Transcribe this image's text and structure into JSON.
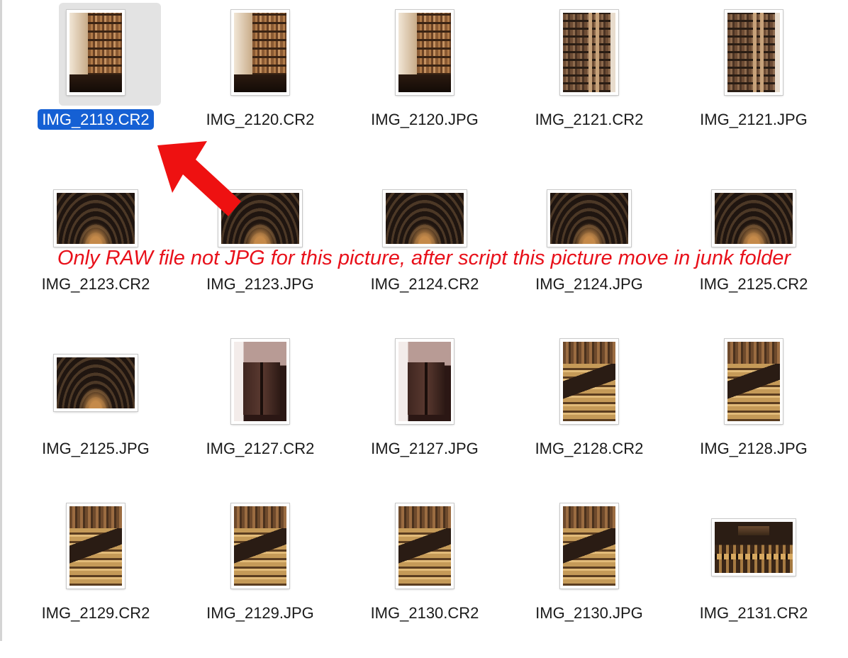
{
  "files": [
    {
      "name": "IMG_2119.CR2",
      "photo": "shelf-tall",
      "orientation": "portrait",
      "selected": true
    },
    {
      "name": "IMG_2120.CR2",
      "photo": "shelf-tall",
      "orientation": "portrait"
    },
    {
      "name": "IMG_2120.JPG",
      "photo": "shelf-tall",
      "orientation": "portrait"
    },
    {
      "name": "IMG_2121.CR2",
      "photo": "ladder",
      "orientation": "portrait"
    },
    {
      "name": "IMG_2121.JPG",
      "photo": "ladder",
      "orientation": "portrait"
    },
    {
      "name": "IMG_2123.CR2",
      "photo": "hall",
      "orientation": "landscape"
    },
    {
      "name": "IMG_2123.JPG",
      "photo": "hall",
      "orientation": "landscape"
    },
    {
      "name": "IMG_2124.CR2",
      "photo": "hall",
      "orientation": "landscape"
    },
    {
      "name": "IMG_2124.JPG",
      "photo": "hall",
      "orientation": "landscape"
    },
    {
      "name": "IMG_2125.CR2",
      "photo": "hall",
      "orientation": "landscape"
    },
    {
      "name": "IMG_2125.JPG",
      "photo": "hall",
      "orientation": "landscape"
    },
    {
      "name": "IMG_2127.CR2",
      "photo": "column",
      "orientation": "portrait"
    },
    {
      "name": "IMG_2127.JPG",
      "photo": "column",
      "orientation": "portrait"
    },
    {
      "name": "IMG_2128.CR2",
      "photo": "balcony",
      "orientation": "portrait"
    },
    {
      "name": "IMG_2128.JPG",
      "photo": "balcony",
      "orientation": "portrait"
    },
    {
      "name": "IMG_2129.CR2",
      "photo": "balcony",
      "orientation": "portrait"
    },
    {
      "name": "IMG_2129.JPG",
      "photo": "balcony",
      "orientation": "portrait"
    },
    {
      "name": "IMG_2130.CR2",
      "photo": "balcony",
      "orientation": "portrait"
    },
    {
      "name": "IMG_2130.JPG",
      "photo": "balcony",
      "orientation": "portrait"
    },
    {
      "name": "IMG_2131.CR2",
      "photo": "facade",
      "orientation": "landscape"
    }
  ],
  "annotation": {
    "text": "Only RAW file not JPG for this picture, after script this picture move in junk folder",
    "color": "#e8101a"
  },
  "colors": {
    "selection": "#1560d4",
    "selection_bg": "#e3e3e3"
  }
}
